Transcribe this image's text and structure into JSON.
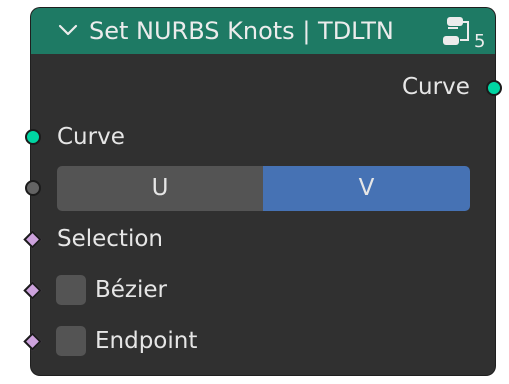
{
  "node": {
    "title": "Set NURBS Knots | TDLTN",
    "user_count": "5",
    "output": {
      "label": "Curve",
      "socket_color": "#00d6a3"
    },
    "inputs": {
      "curve": {
        "label": "Curve",
        "socket_color": "#00d6a3"
      },
      "direction": {
        "options": [
          "U",
          "V"
        ],
        "selected": "V",
        "socket_color": "#636363"
      },
      "selection": {
        "label": "Selection"
      },
      "bezier": {
        "label": "Bézier",
        "checked": false
      },
      "endpoint": {
        "label": "Endpoint",
        "checked": false
      }
    },
    "colors": {
      "header": "#1e7a64",
      "body": "#303030",
      "selected_option": "#4672b4",
      "field_socket": "#cda2dd"
    },
    "icons": [
      "chevron-down-icon",
      "node-group-users-icon"
    ]
  }
}
